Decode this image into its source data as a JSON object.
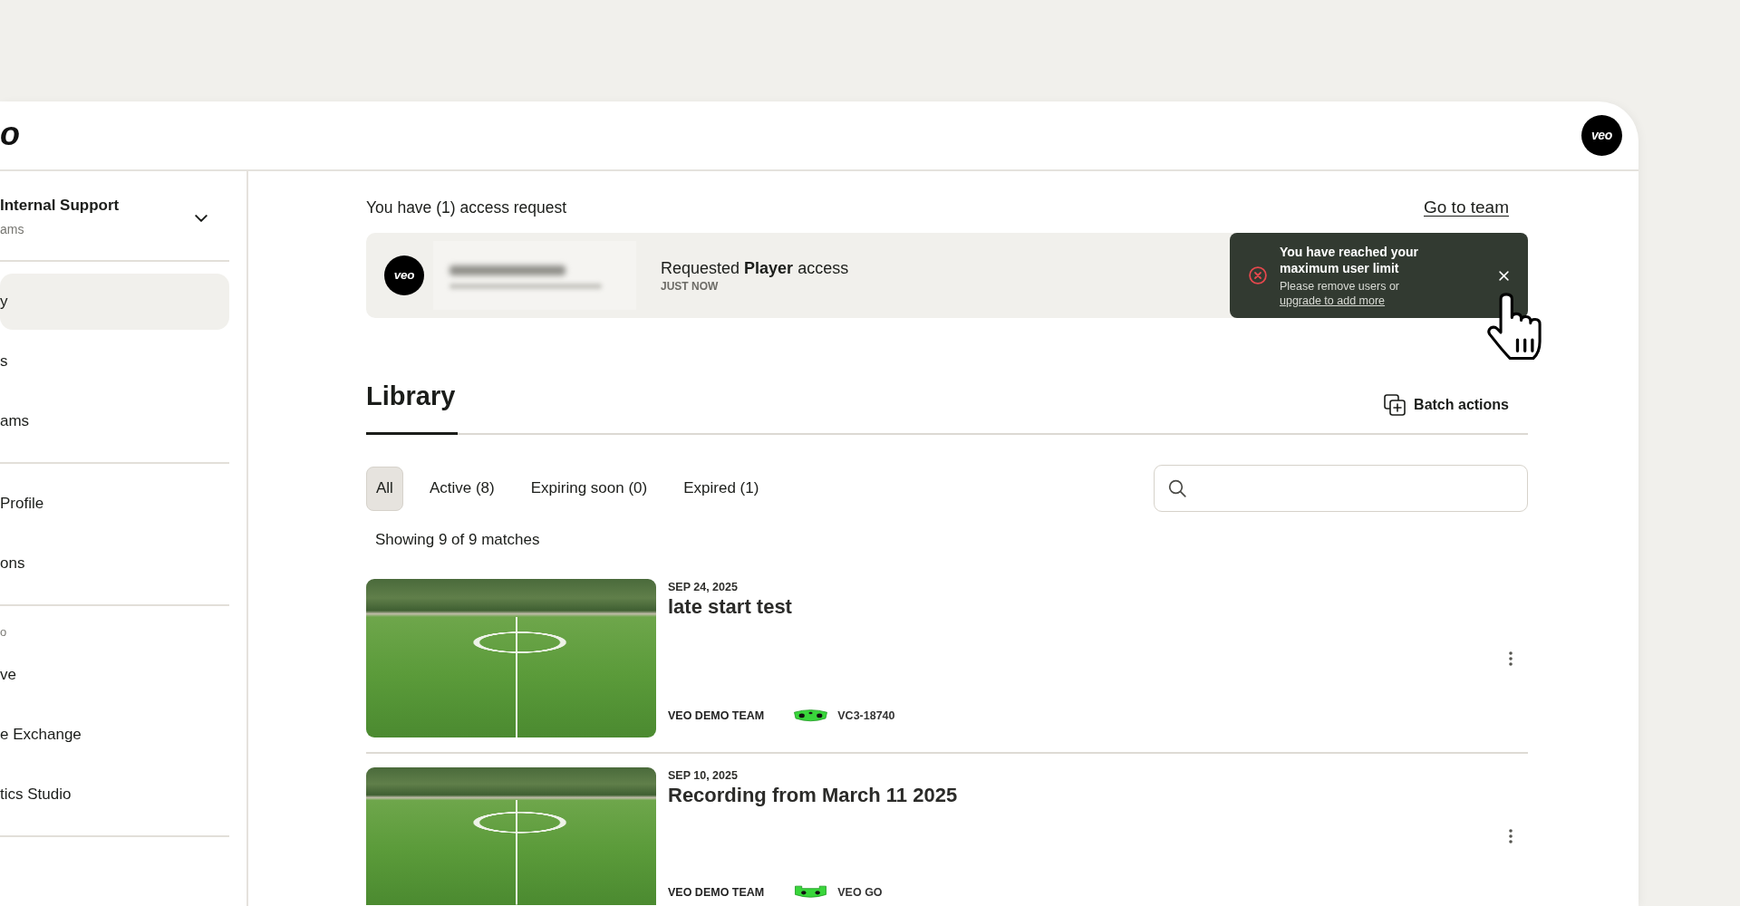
{
  "window": {
    "logo_text": "o",
    "avatar_text": "veo"
  },
  "sidebar": {
    "team": {
      "name": "Internal Support",
      "subtitle": "ams",
      "expanded": false
    },
    "groups": [
      {
        "items": [
          {
            "label": "y",
            "selected": true
          },
          {
            "label": "s",
            "selected": false
          },
          {
            "label": "ams",
            "selected": false
          }
        ]
      },
      {
        "items": [
          {
            "label": "Profile",
            "selected": false
          },
          {
            "label": "ons",
            "selected": false
          }
        ]
      },
      {
        "heading": "o",
        "items": [
          {
            "label": "ve",
            "selected": false
          },
          {
            "label": "e Exchange",
            "selected": false
          },
          {
            "label": "tics Studio",
            "selected": false
          }
        ]
      }
    ]
  },
  "access_requests": {
    "summary": "You have (1) access request",
    "link": "Go to team",
    "request": {
      "avatar_text": "veo",
      "action": "Requested **Player** access",
      "time": "JUST NOW"
    }
  },
  "toast": {
    "title": "You have reached your maximum user limit",
    "message": "Please remove users or",
    "link": "upgrade to add more"
  },
  "library": {
    "tabs": [
      {
        "label": "Library",
        "selected": true
      }
    ],
    "batch_action": "Batch actions",
    "filters": [
      {
        "label": "All",
        "selected": true
      },
      {
        "label": "Active (8)",
        "selected": false
      },
      {
        "label": "Expiring soon (0)",
        "selected": false
      },
      {
        "label": "Expired (1)",
        "selected": false
      }
    ],
    "results": "Showing 9 of 9 matches",
    "recordings": [
      {
        "date": "SEP 24, 2025",
        "title": "late start test",
        "team": "VEO DEMO TEAM",
        "camera": {
          "kind": "vc3",
          "label": "VC3-18740"
        }
      },
      {
        "date": "SEP 10, 2025",
        "title": "Recording from March 11 2025",
        "team": "VEO DEMO TEAM",
        "camera": {
          "kind": "go",
          "label": "VEO GO"
        }
      }
    ]
  }
}
